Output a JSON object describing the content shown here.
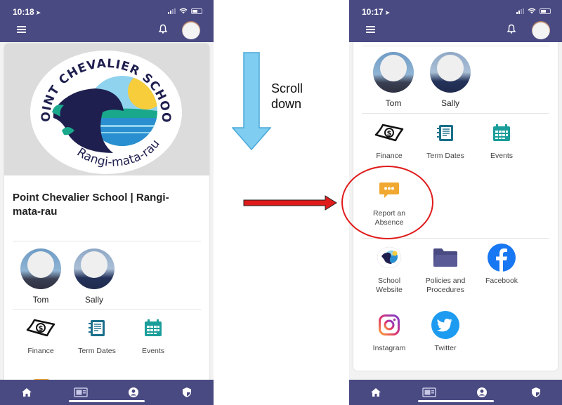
{
  "annotation": {
    "scroll_text_line1": "Scroll",
    "scroll_text_line2": "down",
    "scroll_arrow_color": "#7fcdf0",
    "pointer_arrow_color": "#e01b1b",
    "highlight_color": "#e01b1b"
  },
  "colors": {
    "header_bg": "#4a4a82",
    "teal_icon": "#1a9e9a",
    "orange_icon": "#f0a830",
    "facebook": "#1877f2",
    "twitter": "#1d9bf0",
    "folder": "#4a4a82"
  },
  "left_screen": {
    "status": {
      "time": "10:18",
      "location_glyph": "➤"
    },
    "header": {
      "menu_icon": "hamburger-icon",
      "notification_icon": "bell-icon",
      "profile_icon": "avatar"
    },
    "logo": {
      "top_text": "POINT CHEVALIER SCHOOL",
      "bottom_text": "Rangi-mata-rau"
    },
    "school_title": "Point Chevalier School | Rangi-mata-rau",
    "people": [
      {
        "name": "Tom"
      },
      {
        "name": "Sally"
      }
    ],
    "tiles": [
      {
        "label": "Finance",
        "icon": "money-bill-icon"
      },
      {
        "label": "Term Dates",
        "icon": "notebook-icon"
      },
      {
        "label": "Events",
        "icon": "calendar-icon"
      }
    ],
    "bottom_nav": [
      "home-icon",
      "newspaper-icon",
      "user-circle-icon",
      "shield-icon"
    ]
  },
  "right_screen": {
    "status": {
      "time": "10:17",
      "location_glyph": "➤"
    },
    "header": {
      "menu_icon": "hamburger-icon",
      "notification_icon": "bell-icon",
      "profile_icon": "avatar"
    },
    "people": [
      {
        "name": "Tom"
      },
      {
        "name": "Sally"
      }
    ],
    "tiles": [
      {
        "label": "Finance",
        "icon": "money-bill-icon"
      },
      {
        "label": "Term Dates",
        "icon": "notebook-icon"
      },
      {
        "label": "Events",
        "icon": "calendar-icon"
      },
      {
        "label_line1": "Report an",
        "label_line2": "Absence",
        "icon": "chat-bubble-icon"
      },
      {
        "label_line1": "School",
        "label_line2": "Website",
        "icon": "school-logo-icon"
      },
      {
        "label_line1": "Policies and",
        "label_line2": "Procedures",
        "icon": "folder-icon"
      },
      {
        "label": "Facebook",
        "icon": "facebook-icon"
      },
      {
        "label": "Instagram",
        "icon": "instagram-icon"
      },
      {
        "label": "Twitter",
        "icon": "twitter-icon"
      }
    ],
    "bottom_nav": [
      "home-icon",
      "newspaper-icon",
      "user-circle-icon",
      "shield-icon"
    ]
  }
}
